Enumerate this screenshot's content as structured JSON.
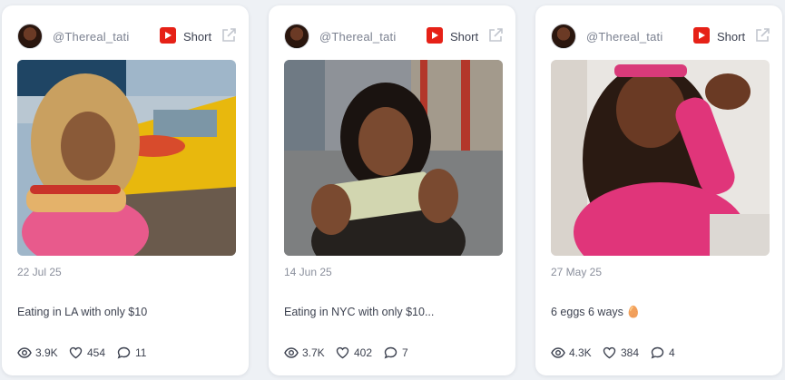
{
  "posts": [
    {
      "handle": "@Thereal_tati",
      "type_label": "Short",
      "date": "22 Jul 25",
      "title": "Eating in LA with only $10",
      "views": "3.9K",
      "likes": "454",
      "comments": "11"
    },
    {
      "handle": "@Thereal_tati",
      "type_label": "Short",
      "date": "14 Jun 25",
      "title": "Eating in NYC with only $10...",
      "views": "3.7K",
      "likes": "402",
      "comments": "7"
    },
    {
      "handle": "@Thereal_tati",
      "type_label": "Short",
      "date": "27 May 25",
      "title": "6 eggs 6 ways 🥚",
      "views": "4.3K",
      "likes": "384",
      "comments": "4"
    }
  ],
  "icons": {
    "platform": "youtube-icon",
    "external": "external-link-icon",
    "views": "eye-icon",
    "likes": "heart-icon",
    "comments": "comment-icon"
  },
  "colors": {
    "youtube_red": "#e62117",
    "page_background": "#eef1f5",
    "card_background": "#ffffff"
  }
}
